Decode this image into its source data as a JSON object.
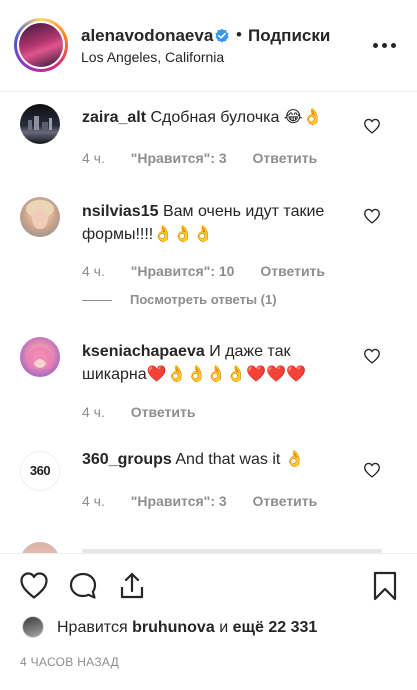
{
  "header": {
    "username": "alenavodonaeva",
    "separator": "•",
    "follow_label": "Подписки",
    "location": "Los Angeles, California"
  },
  "comments": [
    {
      "username": "zaira_alt",
      "text": "Сдобная булочка 😂👌",
      "time": "4 ч.",
      "likes": "\"Нравится\": 3",
      "reply": "Ответить",
      "avatar_icon": "dark-city-photo"
    },
    {
      "username": "nsilvias15",
      "text": "Вам очень идут такие формы!!!!👌👌👌",
      "time": "4 ч.",
      "likes": "\"Нравится\": 10",
      "reply": "Ответить",
      "view_replies": "Посмотреть ответы (1)",
      "avatar_icon": "woman-portrait-photo"
    },
    {
      "username": "kseniachapaeva",
      "text": "И даже так шикарна❤️👌👌👌👌❤️❤️❤️",
      "time": "4 ч.",
      "reply": "Ответить",
      "avatar_icon": "pink-hair-photo"
    },
    {
      "username": "360_groups",
      "text": "And that was it 👌",
      "time": "4 ч.",
      "likes": "\"Нравится\": 3",
      "reply": "Ответить",
      "avatar_icon": "360-logo",
      "avatar_text": "360"
    }
  ],
  "likes_row": {
    "prefix": "Нравится",
    "user": "bruhunova",
    "conj": "и",
    "others": "ещё 22 331"
  },
  "timestamp": "4 ЧАСОВ НАЗАД",
  "colors": {
    "text": "#262626",
    "muted": "#8e8e8e",
    "verified": "#3897f0",
    "border": "#efefef"
  }
}
